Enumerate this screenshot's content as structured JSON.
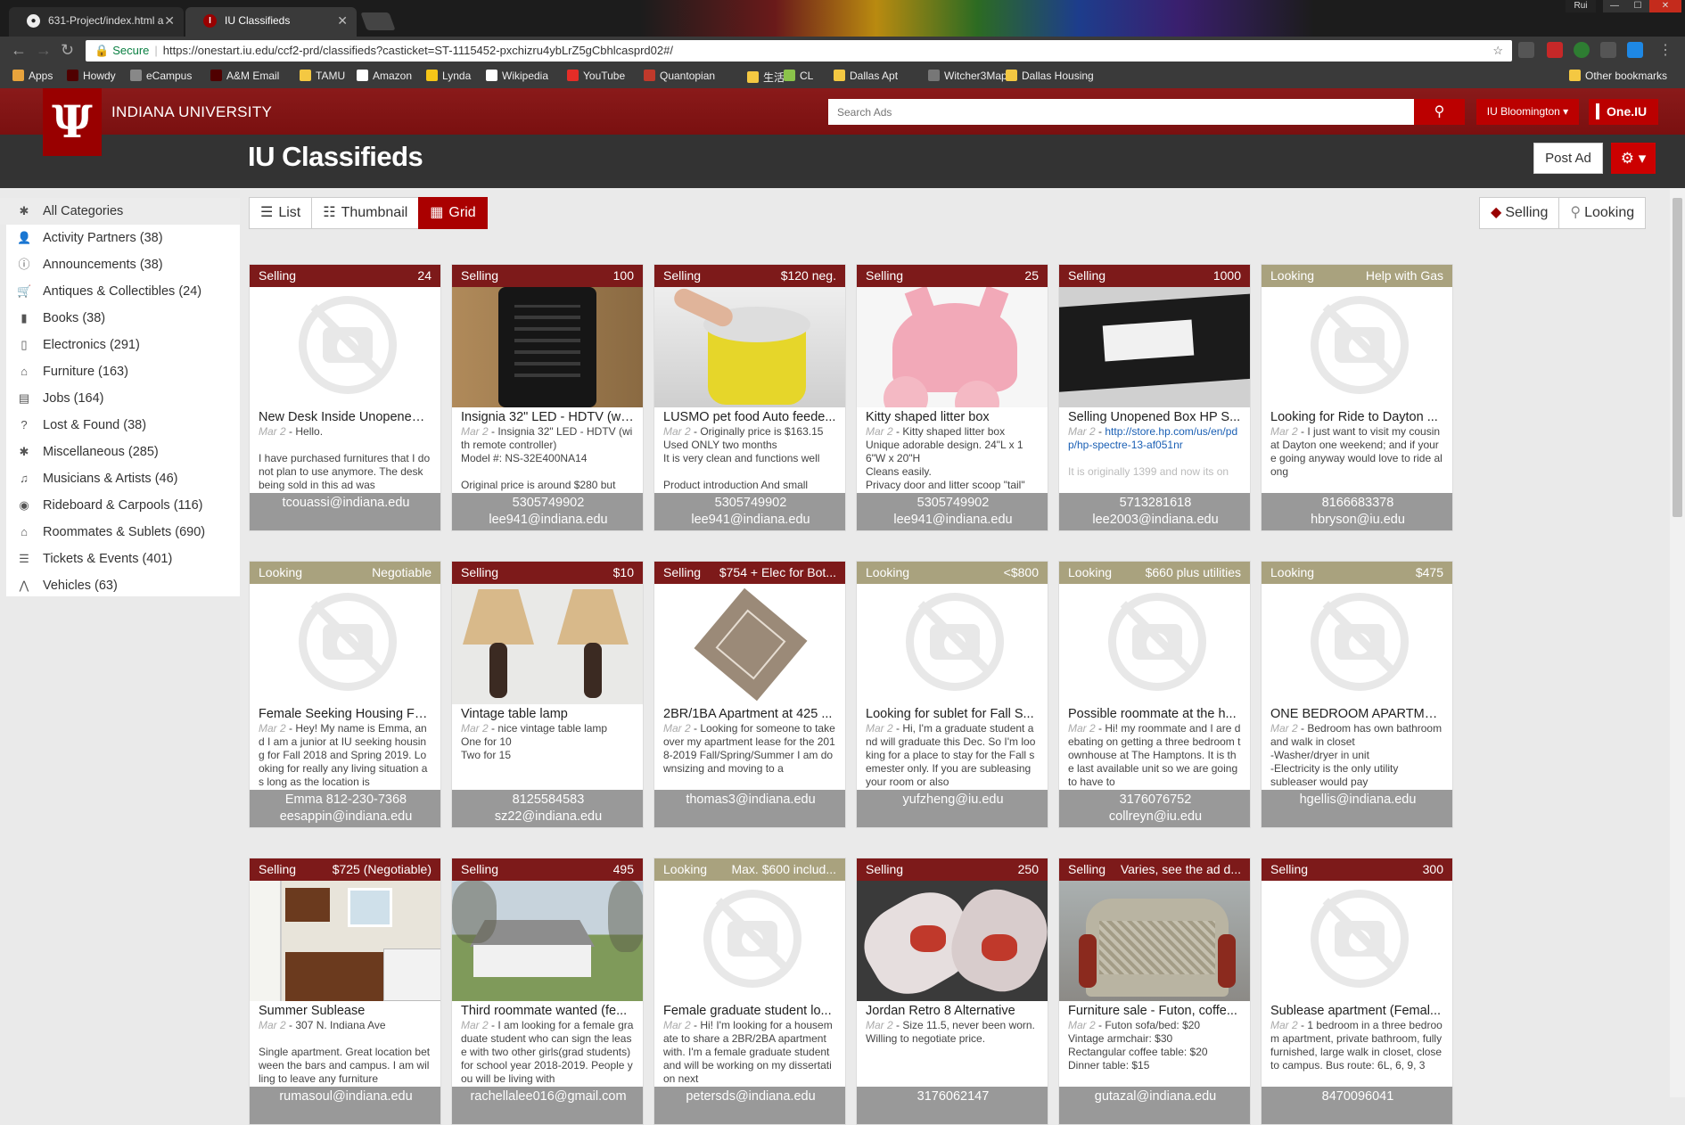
{
  "browser": {
    "tabs": [
      {
        "title": "631-Project/index.html a",
        "icon": "github-icon"
      },
      {
        "title": "IU Classifieds",
        "icon": "iu-icon"
      }
    ],
    "user": "Rui",
    "url": {
      "secure_label": "Secure",
      "text": "https://onestart.iu.edu/ccf2-prd/classifieds?casticket=ST-1115452-pxchizru4ybLrZ5gCbhlcasprd02#/"
    },
    "bookmarks": [
      {
        "label": "Apps",
        "icon": "apps-grid-icon",
        "color": "#e8a33c"
      },
      {
        "label": "Howdy",
        "icon": "tamu-icon",
        "color": "#500000"
      },
      {
        "label": "eCampus",
        "icon": "page-icon",
        "color": "#888888"
      },
      {
        "label": "A&M Email",
        "icon": "tamu-icon",
        "color": "#500000"
      },
      {
        "label": "TAMU",
        "icon": "folder-icon",
        "color": "#f4c842"
      },
      {
        "label": "Amazon",
        "icon": "amazon-icon",
        "color": "#ffffff"
      },
      {
        "label": "Lynda",
        "icon": "lynda-icon",
        "color": "#f5c518"
      },
      {
        "label": "Wikipedia",
        "icon": "wikipedia-icon",
        "color": "#ffffff"
      },
      {
        "label": "YouTube",
        "icon": "youtube-icon",
        "color": "#e52d27"
      },
      {
        "label": "Quantopian",
        "icon": "quantopian-icon",
        "color": "#c0392b"
      },
      {
        "label": "生活",
        "icon": "folder-icon",
        "color": "#f4c842"
      },
      {
        "label": "CL",
        "icon": "craigslist-icon",
        "color": "#8bc34a"
      },
      {
        "label": "Dallas Apt",
        "icon": "folder-icon",
        "color": "#f4c842"
      },
      {
        "label": "Witcher3Map",
        "icon": "map-icon",
        "color": "#777777"
      },
      {
        "label": "Dallas Housing",
        "icon": "folder-icon",
        "color": "#f4c842"
      }
    ],
    "other_bookmarks": "Other bookmarks"
  },
  "header": {
    "university": "INDIANA UNIVERSITY",
    "search_placeholder": "Search Ads",
    "campus": "IU Bloomington ▾",
    "one_iu": "One.IU",
    "page_title": "IU Classifieds",
    "post_ad": "Post Ad",
    "brand_color": "#990000"
  },
  "sidebar": {
    "items": [
      {
        "label": "All Categories",
        "icon": "asterisk-icon"
      },
      {
        "label": "Activity Partners (38)",
        "icon": "user-icon"
      },
      {
        "label": "Announcements (38)",
        "icon": "info-circle-icon"
      },
      {
        "label": "Antiques & Collectibles (24)",
        "icon": "cart-icon"
      },
      {
        "label": "Books (38)",
        "icon": "book-icon"
      },
      {
        "label": "Electronics (291)",
        "icon": "mobile-icon"
      },
      {
        "label": "Furniture (163)",
        "icon": "home-icon"
      },
      {
        "label": "Jobs (164)",
        "icon": "file-icon"
      },
      {
        "label": "Lost & Found (38)",
        "icon": "question-circle-icon"
      },
      {
        "label": "Miscellaneous (285)",
        "icon": "asterisk-icon"
      },
      {
        "label": "Musicians & Artists (46)",
        "icon": "music-icon"
      },
      {
        "label": "Rideboard & Carpools (116)",
        "icon": "globe-icon"
      },
      {
        "label": "Roommates & Sublets (690)",
        "icon": "home-icon"
      },
      {
        "label": "Tickets & Events (401)",
        "icon": "list-icon"
      },
      {
        "label": "Vehicles (63)",
        "icon": "road-icon"
      }
    ]
  },
  "views": {
    "list": "List",
    "thumbnail": "Thumbnail",
    "grid": "Grid",
    "selling": "Selling",
    "looking": "Looking"
  },
  "ads": [
    {
      "type": "Selling",
      "price": "24",
      "title": "New Desk Inside Unopened ...",
      "date": "Mar 2",
      "body": " - Hello.\n\nI have purchased furnitures that I do not plan to use anymore. The desk being sold in this ad was",
      "contact1": "tcouassi@indiana.edu",
      "contact2": "",
      "image": "none"
    },
    {
      "type": "Selling",
      "price": "100",
      "title": "Insignia 32\" LED - HDTV (wi...",
      "date": "Mar 2",
      "body": " - Insignia 32\" LED - HDTV (with remote controller)\nModel #: NS-32E400NA14\n\nOriginal price is around $280 but",
      "contact1": "5305749902",
      "contact2": "lee941@indiana.edu",
      "image": "remote"
    },
    {
      "type": "Selling",
      "price": "$120 neg.",
      "title": "LUSMO pet food Auto feede...",
      "date": "Mar 2",
      "body": " - Originally price is $163.15\nUsed ONLY two months\nIt is very clean and functions well\n\nProduct introduction And small",
      "contact1": "5305749902",
      "contact2": "lee941@indiana.edu",
      "image": "feeder"
    },
    {
      "type": "Selling",
      "price": "25",
      "title": "Kitty shaped litter box",
      "date": "Mar 2",
      "body": " - Kitty shaped litter box\nUnique adorable design. 24\"L x 16\"W x 20\"H\nCleans easily.\nPrivacy door and litter scoop \"tail\"",
      "contact1": "5305749902",
      "contact2": "lee941@indiana.edu",
      "image": "litter"
    },
    {
      "type": "Selling",
      "price": "1000",
      "title": "Selling Unopened Box HP S...",
      "date": "Mar 2",
      "body": " - ",
      "link": "http://store.hp.com/us/en/pdp/hp-spectre-13-af051nr",
      "body2": "\n\nIt is originally 1399 and now its on",
      "contact1": "5713281618",
      "contact2": "lee2003@indiana.edu",
      "image": "box"
    },
    {
      "type": "Looking",
      "price": "Help with Gas",
      "title": "Looking for Ride to Dayton ...",
      "date": "Mar 2",
      "body": " - I just want to visit my cousin at Dayton one weekend; and if youre going anyway would love to ride along",
      "contact1": "8166683378",
      "contact2": "hbryson@iu.edu",
      "image": "none"
    },
    {
      "type": "Looking",
      "price": "Negotiable",
      "title": "Female Seeking Housing Fo...",
      "date": "Mar 2",
      "body": " - Hey! My name is Emma, and I am a junior at IU seeking housing for Fall 2018 and Spring 2019. Looking for really any living situation as long as the location is",
      "contact1": "Emma 812-230-7368",
      "contact2": "eesappin@indiana.edu",
      "image": "none"
    },
    {
      "type": "Selling",
      "price": "$10",
      "title": "Vintage table lamp",
      "date": "Mar 2",
      "body": " - nice vintage table lamp\nOne for 10\nTwo for 15",
      "contact1": "8125584583",
      "contact2": "sz22@indiana.edu",
      "image": "lamps"
    },
    {
      "type": "Selling",
      "price": "$754 + Elec for Bot...",
      "title": "2BR/1BA Apartment at 425 ...",
      "date": "Mar 2",
      "body": " - Looking for someone to take over my apartment lease for the 2018-2019 Fall/Spring/Summer I am downsizing and moving to a",
      "contact1": "thomas3@indiana.edu",
      "contact2": "",
      "image": "floorplan"
    },
    {
      "type": "Looking",
      "price": "<$800",
      "title": "Looking for sublet for Fall S...",
      "date": "Mar 2",
      "body": " - Hi, I'm a graduate student and will graduate this Dec. So I'm looking for a place to stay for the Fall semester only. If you are subleasing your room or also",
      "contact1": "yufzheng@iu.edu",
      "contact2": "",
      "image": "none"
    },
    {
      "type": "Looking",
      "price": "$660 plus utilities",
      "title": "Possible roommate at the h...",
      "date": "Mar 2",
      "body": " - Hi! my roommate and I are debating on getting a three bedroom townhouse at The Hamptons. It is the last available unit so we are going to have to",
      "contact1": "3176076752",
      "contact2": "collreyn@iu.edu",
      "image": "none"
    },
    {
      "type": "Looking",
      "price": "$475",
      "title": "ONE BEDROOM APARTME...",
      "date": "Mar 2",
      "body": " - Bedroom has own bathroom and walk in closet\n-Washer/dryer in unit\n-Electricity is the only utility\nsubleaser would pay",
      "contact1": "hgellis@indiana.edu",
      "contact2": "",
      "image": "none"
    },
    {
      "type": "Selling",
      "price": "$725 (Negotiable)",
      "title": "Summer Sublease",
      "date": "Mar 2",
      "body": " - 307 N. Indiana Ave\n\nSingle apartment. Great location between the bars and campus. I am willing to leave any furniture",
      "contact1": "rumasoul@indiana.edu",
      "contact2": "",
      "image": "kitchen"
    },
    {
      "type": "Selling",
      "price": "495",
      "title": "Third roommate wanted (fe...",
      "date": "Mar 2",
      "body": " - I am looking for a female graduate student who can sign the lease with two other girls(grad students) for school year 2018-2019. People you will be living with",
      "contact1": "rachellalee016@gmail.com",
      "contact2": "",
      "image": "house"
    },
    {
      "type": "Looking",
      "price": "Max. $600 includ...",
      "title": "Female graduate student lo...",
      "date": "Mar 2",
      "body": " - Hi! I'm looking for a housemate to share a 2BR/2BA apartment with. I'm a female graduate student and will be working on my dissertation next",
      "contact1": "petersds@indiana.edu",
      "contact2": "",
      "image": "none"
    },
    {
      "type": "Selling",
      "price": "250",
      "title": "Jordan Retro 8 Alternative",
      "date": "Mar 2",
      "body": " - Size 11.5, never been worn. Willing to negotiate price.",
      "contact1": "3176062147",
      "contact2": "",
      "image": "shoes"
    },
    {
      "type": "Selling",
      "price": "Varies, see the ad d...",
      "title": "Furniture sale - Futon, coffe...",
      "date": "Mar 2",
      "body": " - Futon sofa/bed: $20\nVintage armchair: $30\nRectangular coffee table: $20\nDinner table: $15",
      "contact1": "gutazal@indiana.edu",
      "contact2": "",
      "image": "chair"
    },
    {
      "type": "Selling",
      "price": "300",
      "title": "Sublease apartment (Femal...",
      "date": "Mar 2",
      "body": " - 1 bedroom in a three bedroom apartment, private bathroom, fully furnished, large walk in closet, close to campus. Bus route: 6L, 6, 9, 3",
      "contact1": "8470096041",
      "contact2": "",
      "image": "none"
    }
  ]
}
